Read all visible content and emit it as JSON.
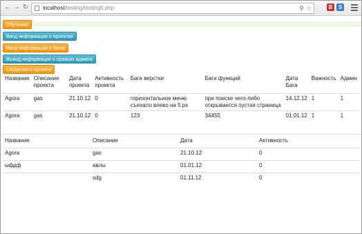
{
  "browser": {
    "url_host": "localhost",
    "url_path": "/testing/testing5.php",
    "nav_icons": [
      "back-arrow-icon",
      "forward-arrow-icon",
      "reload-icon"
    ],
    "ext_labels": [
      "B",
      "S"
    ],
    "colors": {
      "ext_red": "#c9302c",
      "ext_blue": "#3d7bc8"
    }
  },
  "buttons": [
    {
      "label": "Обучение",
      "color": "orange"
    },
    {
      "label": "Ввод информации о проектах",
      "color": "blue"
    },
    {
      "label": "Ввод информации о багах",
      "color": "orange"
    },
    {
      "label": "Вывод информации о правках админа",
      "color": "blue"
    },
    {
      "label": "Сведения о проекте",
      "color": "orange"
    }
  ],
  "bugs_table": {
    "headers": [
      "Название",
      "Описание проекта",
      "Дата проекта",
      "Активность проекта",
      "Баги верстки",
      "Баги функций",
      "Дата Бага",
      "Важность",
      "Админ"
    ],
    "rows": [
      [
        "Agora",
        "gas",
        "21.10.12",
        "0",
        "горизонтальное меню съехало влево на 5 px",
        "при поиске чего-либо открывается пустая страница",
        "14.12.12",
        "1",
        "1"
      ],
      [
        "Agora",
        "gas",
        "21.10.12",
        "0",
        "123",
        "34455",
        "01.01.12",
        "1",
        "1"
      ]
    ]
  },
  "projects_table": {
    "headers": [
      "Название",
      "Описание",
      "Дата",
      "Активность"
    ],
    "rows": [
      [
        "Agora",
        "gas",
        "21.10.12",
        "0"
      ],
      [
        "ыфдф",
        "авлы",
        "01.01.12",
        "0"
      ],
      [
        "",
        "sdg",
        "01.11.12",
        "0"
      ]
    ]
  }
}
